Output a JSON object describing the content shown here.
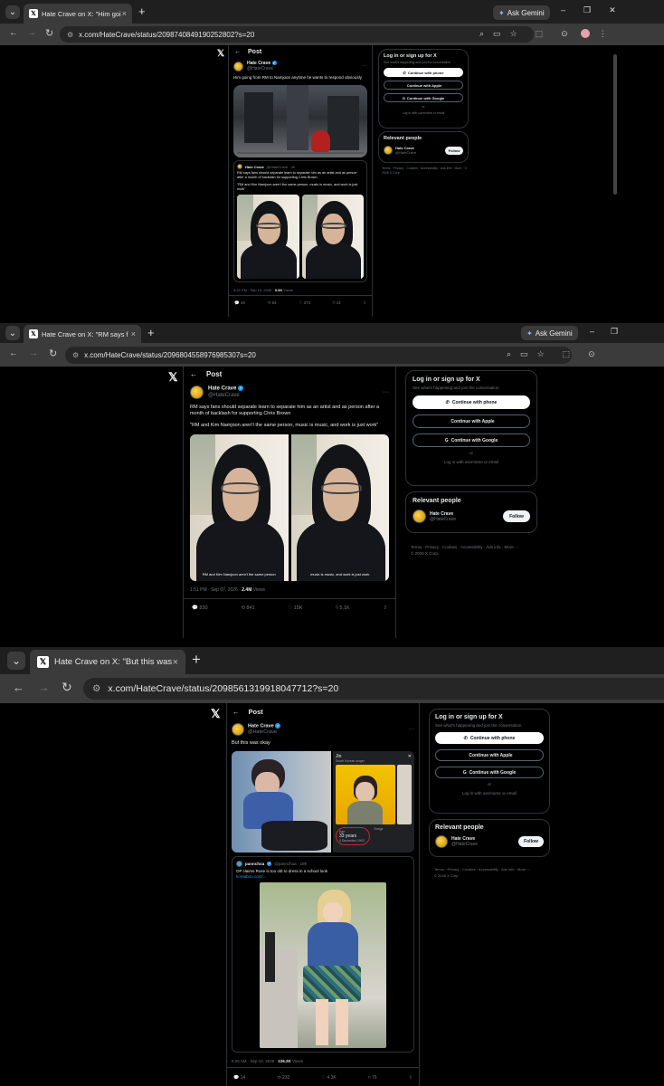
{
  "browser": {
    "ask_gemini": "Ask Gemini",
    "new_tab_symbol": "+",
    "tab_close_symbol": "×",
    "dropdown_symbol": "⌄",
    "gemini_symbol": "✦",
    "back_symbol": "←",
    "forward_symbol": "→",
    "reload_symbol": "↻",
    "tune_symbol": "⚙",
    "minimize_symbol": "–",
    "maximize_symbol": "❐",
    "close_symbol": "✕"
  },
  "shot1": {
    "tab_title": "Hate Crave on X: \"Him going f...",
    "url": "x.com/HateCrave/status/2098740849190252802?s=20",
    "post_header": "Post",
    "author_name": "Hate Crave",
    "author_handle": "@HateCrave",
    "text": "Him going from RM to Namjoon anytime he wants to respond obviously",
    "quote_author": "Hate Crave",
    "quote_handle": "@HateCrave · 4h",
    "quote_text": "RM says fans should separate learn to separate him as an artist and as person after a month of backlash for supporting Chris Brown",
    "quote_text2": "\"RM and Kim Namjoon aren't the same person, music is music, and work is just work\"",
    "meta": "5:22 PM · Sep 10, 2026 · ",
    "views": "9.9K",
    "views_label": " Views",
    "replies": "48",
    "reposts": "54",
    "likes": "373",
    "bookmarks": "43",
    "login_title": "Log in or sign up for X",
    "login_sub": "See what's happening and join the conversation",
    "btn_phone": "Continue with phone",
    "btn_apple": "Continue with Apple",
    "btn_google": "Continue with Google",
    "or": "or",
    "login_link": "Log in with username or email",
    "relevant": "Relevant people",
    "rel_name": "Hate Crave",
    "rel_handle": "@HateCrave",
    "follow": "Follow",
    "footer": "Terms · Privacy · Cookies · Accessibility · Ads info · More · © 2026 X Corp."
  },
  "shot2": {
    "tab_title": "Hate Crave on X: \"RM says fans",
    "url": "x.com/HateCrave/status/2096804558976985307s=20",
    "post_header": "Post",
    "author_name": "Hate Crave",
    "author_handle": "@HateCrave",
    "text": "RM says fans should separate learn to separate him as an artist and as person after a month of backlash for supporting Chris Brown",
    "text2": "\"RM and Kim Namjoon aren't the same person, music is music, and work is just work\"",
    "cap_left": "RM and Kim Namjoon aren't the same person",
    "cap_right": "music is music, and work is just work",
    "meta": "1:51 PM · Sep 07, 2026 · ",
    "views": "2.4M",
    "views_label": " Views",
    "replies": "830",
    "reposts": "841",
    "likes": "15K",
    "bookmarks": "5.1K",
    "login_title": "Log in or sign up for X",
    "login_sub": "See what's happening and join the conversation.",
    "btn_phone": "Continue with phone",
    "btn_apple": "Continue with Apple",
    "btn_google": "Continue with Google",
    "or": "or",
    "login_link": "Log in with username or email",
    "relevant": "Relevant people",
    "rel_name": "Hate Crave",
    "rel_handle": "@HateCrave",
    "follow": "Follow",
    "footer1": "Terms · Privacy · Cookies · Accessibility · Ads info · More ···",
    "footer2": "© 2026 X Corp."
  },
  "shot3": {
    "tab_title": "Hate Crave on X: \"But this was o",
    "url": "x.com/HateCrave/status/2098561319918047712?s=20",
    "post_header": "Post",
    "author_name": "Hate Crave",
    "author_handle": "@HateCrave",
    "text": "But this was okay",
    "panel_name": "Jin",
    "panel_sub": "South Korean singer",
    "panel_age_label": "Age",
    "panel_age": "33 years",
    "panel_born": "4 December 1992",
    "panel_songs": "Songs",
    "quote_author": "pannchoa",
    "quote_handle": "@pannchoa · 19h",
    "quote_text": "OP claims Rose is too old to dress in a school look",
    "quote_link": "koreaboo.com/...",
    "meta": "5:26 AM · Sep 12, 2026 · ",
    "views": "126.2K",
    "views_label": " Views",
    "replies": "14",
    "reposts": "232",
    "likes": "4.3K",
    "bookmarks": "76",
    "login_title": "Log in or sign up for X",
    "login_sub": "See what's happening and join the conversation.",
    "btn_phone": "Continue with phone",
    "btn_apple": "Continue with Apple",
    "btn_google": "Continue with Google",
    "or": "or",
    "login_link": "Log in with username or email",
    "relevant": "Relevant people",
    "rel_name": "Hate Crave",
    "rel_handle": "@HateCrave",
    "follow": "Follow",
    "footer1": "Terms · Privacy · Cookies · Accessibility · Ads info · More ···",
    "footer2": "© 2026 X Corp."
  },
  "icons": {
    "x_logo": "𝕏",
    "back_arrow": "←",
    "reply": "💬",
    "repost": "⟲",
    "like": "♡",
    "bookmark": "⌑",
    "share": "⇪",
    "more": "···",
    "verified": "✓",
    "phone": "✆",
    "apple": "",
    "google": "G"
  },
  "colors": {
    "accent_blue": "#1d9bf0",
    "background": "#000000",
    "border": "#2f3336"
  }
}
